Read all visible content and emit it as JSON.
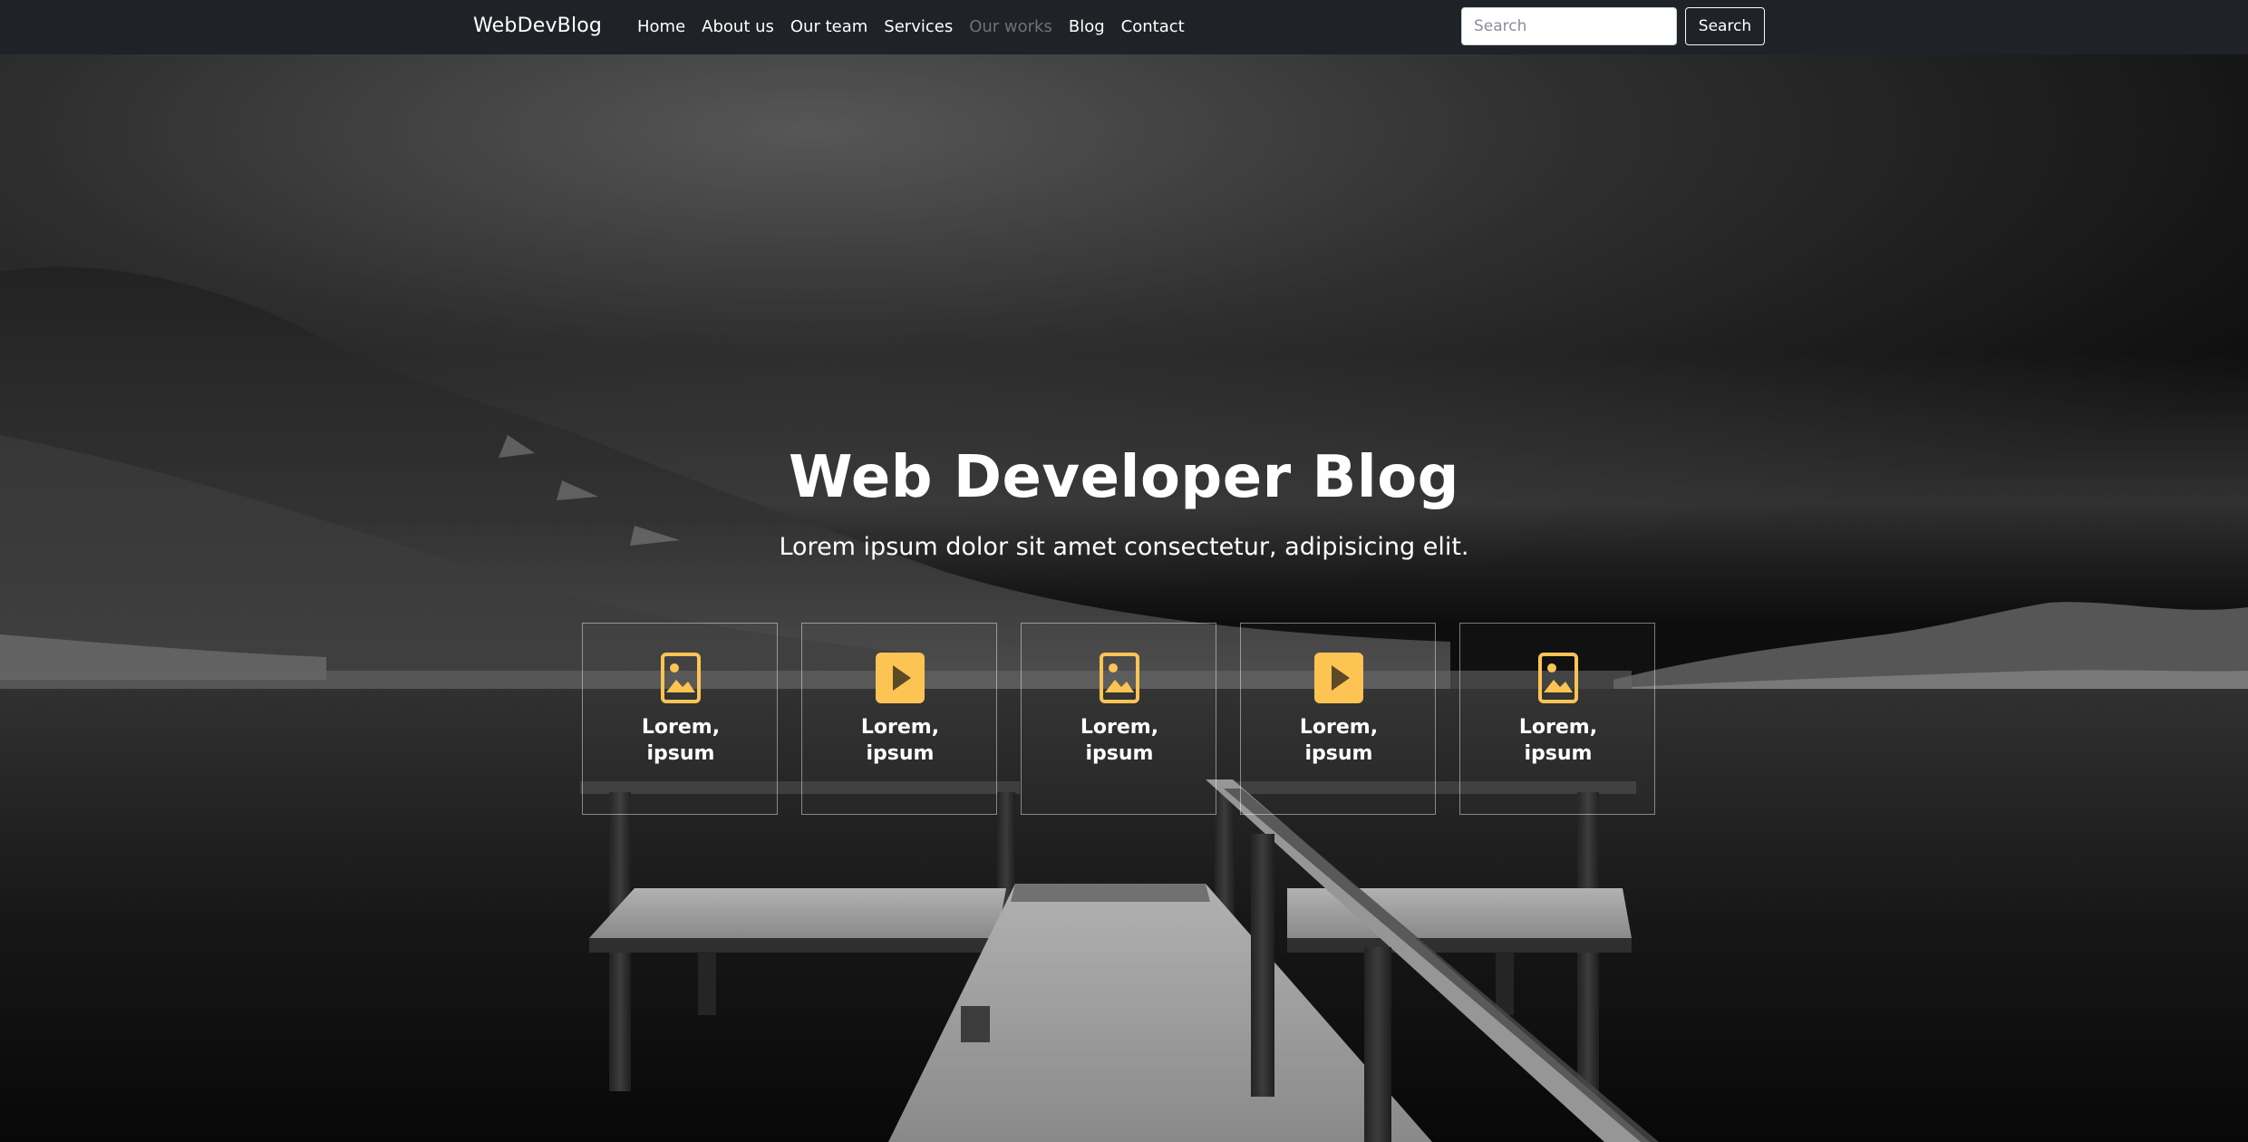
{
  "navbar": {
    "brand": "WebDevBlog",
    "links": [
      "Home",
      "About us",
      "Our team",
      "Services",
      "Our works",
      "Blog",
      "Contact"
    ],
    "active_link": "Our works",
    "search": {
      "placeholder": "Search",
      "button_label": "Search"
    }
  },
  "hero": {
    "title": "Web Developer Blog",
    "subtitle": "Lorem ipsum dolor sit amet consectetur, adipisicing elit."
  },
  "cards": [
    {
      "icon": "image-icon",
      "title": "Lorem, ipsum"
    },
    {
      "icon": "play-icon",
      "title": "Lorem, ipsum"
    },
    {
      "icon": "image-icon",
      "title": "Lorem, ipsum"
    },
    {
      "icon": "play-icon",
      "title": "Lorem, ipsum"
    },
    {
      "icon": "image-icon",
      "title": "Lorem, ipsum"
    }
  ],
  "colors": {
    "navbar_bg": "#1f2227",
    "accent_yellow": "#fdc454",
    "inactive_link": "#6f7378"
  }
}
